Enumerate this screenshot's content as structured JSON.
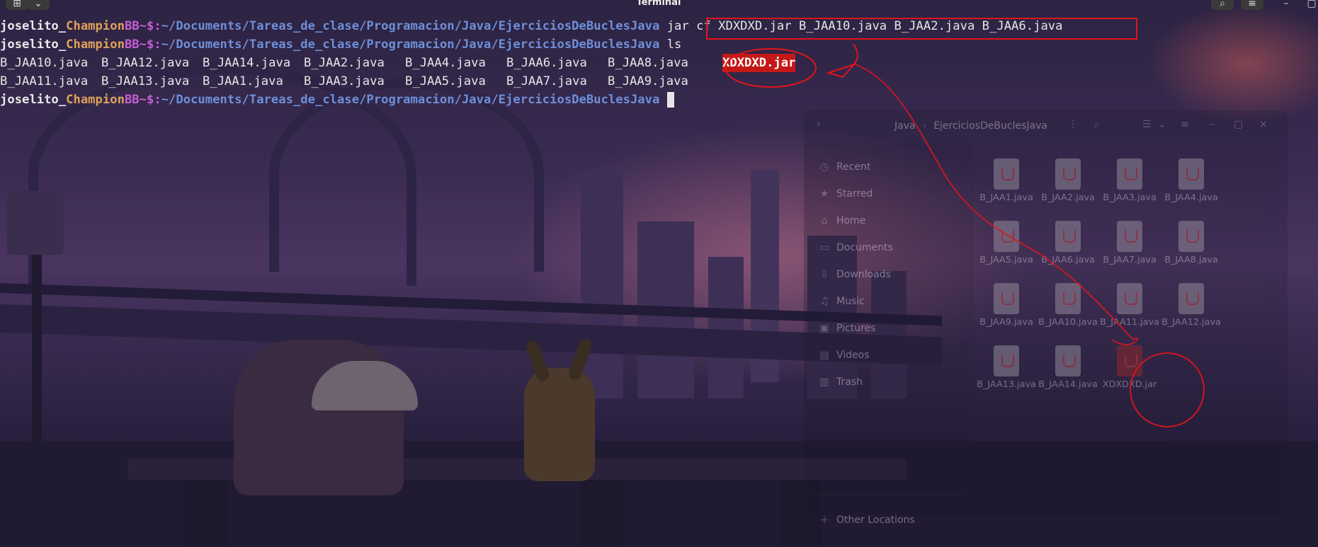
{
  "window": {
    "title": "Terminal"
  },
  "terminal": {
    "prompt": {
      "user_a": "joselito_",
      "user_b": "Champion",
      "user_c": "BB",
      "symbols": "~$:",
      "path": "~/Documents/Tareas_de_clase/Programacion/Java/EjerciciosDeBuclesJava"
    },
    "command1": "jar cf XDXDXD.jar B_JAA10.java B_JAA2.java B_JAA6.java",
    "command2": "ls",
    "ls_row1": [
      "B_JAA10.java",
      "B_JAA12.java",
      "B_JAA14.java",
      "B_JAA2.java",
      "B_JAA4.java",
      "B_JAA6.java",
      "B_JAA8.java"
    ],
    "ls_row1_jar": "XDXDXD.jar",
    "ls_row2": [
      "B_JAA11.java",
      "B_JAA13.java",
      "B_JAA1.java",
      "B_JAA3.java",
      "B_JAA5.java",
      "B_JAA7.java",
      "B_JAA9.java"
    ]
  },
  "file_manager": {
    "breadcrumb": [
      "Java",
      "EjerciciosDeBuclesJava"
    ],
    "sidebar": [
      {
        "label": "Recent",
        "icon": "clock-icon",
        "glyph": "◷"
      },
      {
        "label": "Starred",
        "icon": "star-icon",
        "glyph": "★"
      },
      {
        "label": "Home",
        "icon": "home-icon",
        "glyph": "⌂"
      },
      {
        "label": "Documents",
        "icon": "document-icon",
        "glyph": "▭"
      },
      {
        "label": "Downloads",
        "icon": "download-icon",
        "glyph": "⇩"
      },
      {
        "label": "Music",
        "icon": "music-icon",
        "glyph": "♫"
      },
      {
        "label": "Pictures",
        "icon": "picture-icon",
        "glyph": "▣"
      },
      {
        "label": "Videos",
        "icon": "video-icon",
        "glyph": "▤"
      },
      {
        "label": "Trash",
        "icon": "trash-icon",
        "glyph": "▥"
      }
    ],
    "other_locations": "Other Locations",
    "files": [
      "B_JAA1.java",
      "B_JAA2.java",
      "B_JAA3.java",
      "B_JAA4.java",
      "B_JAA5.java",
      "B_JAA6.java",
      "B_JAA7.java",
      "B_JAA8.java",
      "B_JAA9.java",
      "B_JAA10.java",
      "B_JAA11.java",
      "B_JAA12.java",
      "B_JAA13.java",
      "B_JAA14.java",
      "XDXDXD.jar"
    ]
  },
  "colors": {
    "highlight_red": "#e0141c",
    "prompt_path": "#6f8fd8",
    "prompt_orange": "#e0a25a",
    "prompt_purple": "#c55fd4"
  }
}
